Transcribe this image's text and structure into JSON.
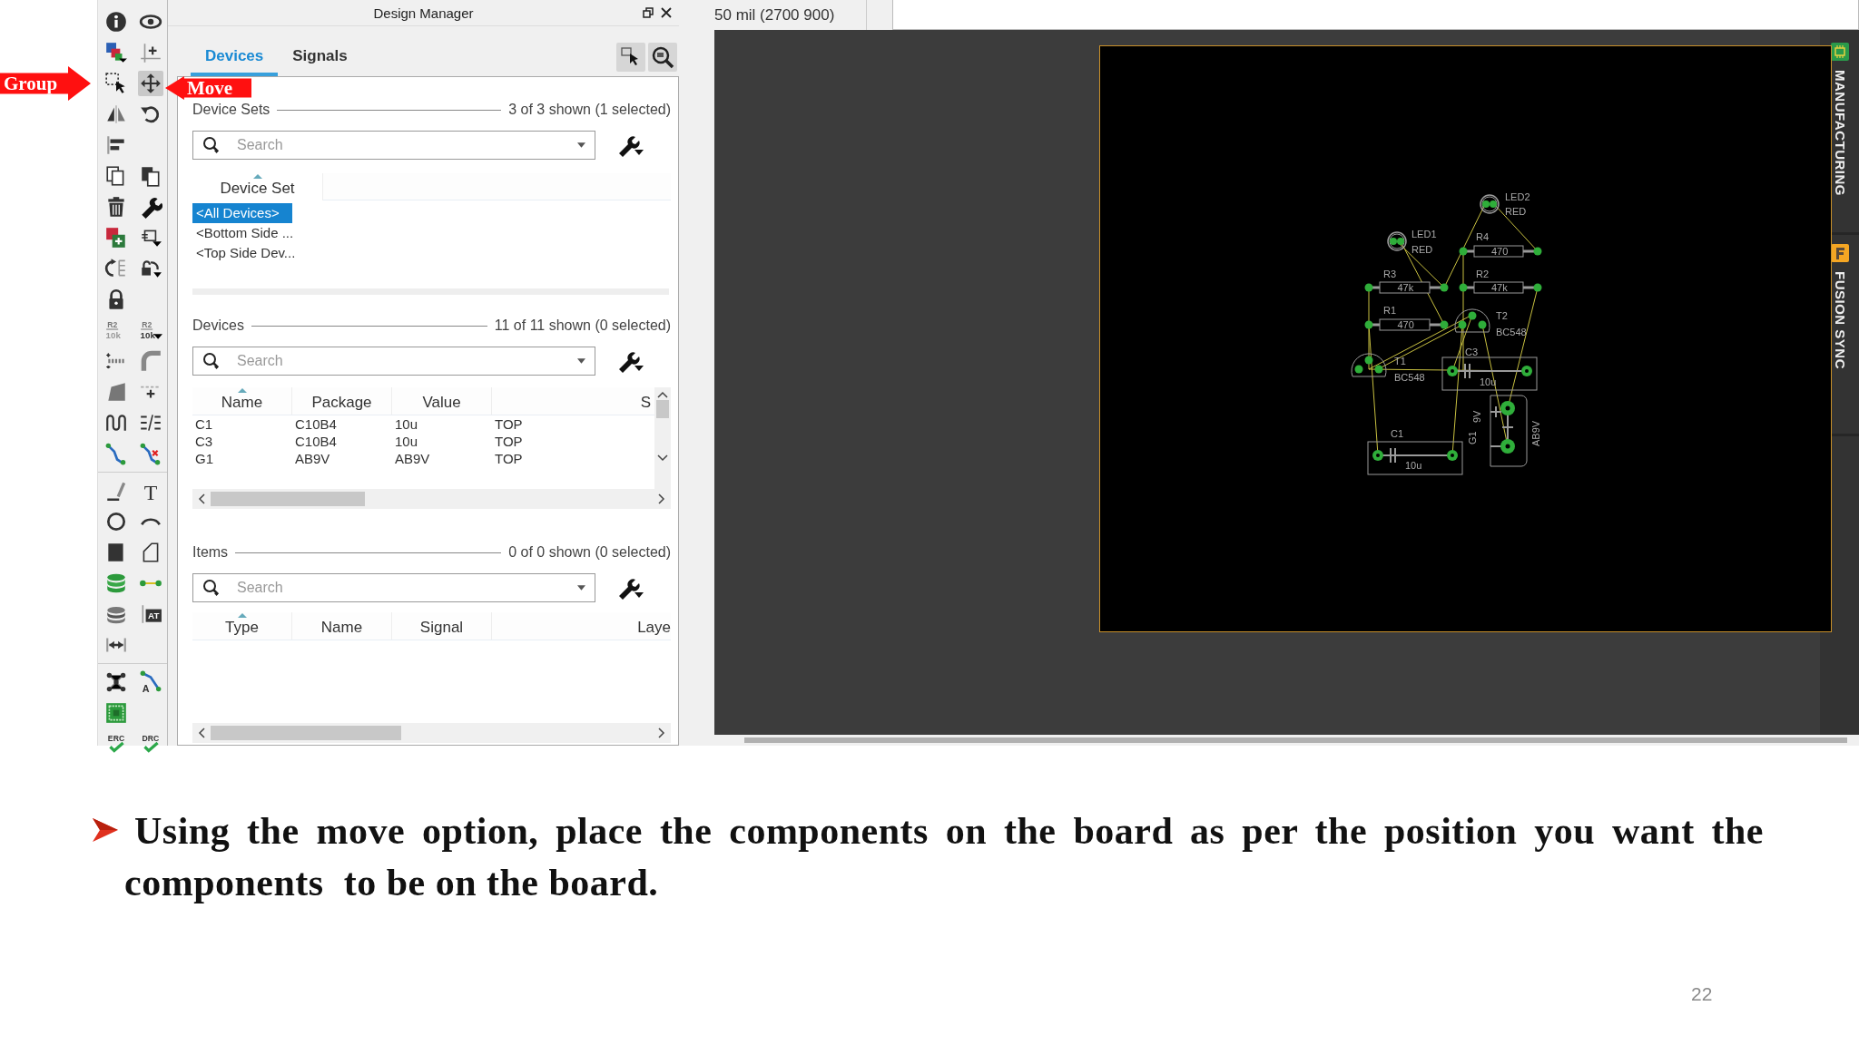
{
  "annotations": [
    {
      "label": "Group",
      "kind": "right"
    },
    {
      "label": "Move",
      "kind": "left"
    }
  ],
  "toolbar": {
    "groups": [
      [
        [
          {
            "kind": "info",
            "selected": false
          },
          {
            "kind": "eye",
            "selected": false
          }
        ],
        [
          {
            "kind": "layers",
            "selected": false
          },
          {
            "kind": "origin",
            "selected": false
          }
        ],
        [
          {
            "kind": "group",
            "selected": false
          },
          {
            "kind": "move",
            "selected": true
          }
        ],
        [
          {
            "kind": "mirror",
            "selected": false
          },
          {
            "kind": "rotate",
            "selected": false
          }
        ],
        [
          {
            "kind": "align",
            "selected": false
          }
        ],
        [
          {
            "kind": "copy",
            "selected": false
          },
          {
            "kind": "paste",
            "selected": false
          }
        ],
        [
          {
            "kind": "delete",
            "selected": false
          },
          {
            "kind": "wrench",
            "selected": false
          }
        ],
        [
          {
            "kind": "add",
            "selected": false
          },
          {
            "kind": "replace",
            "selected": false
          }
        ],
        [
          {
            "kind": "swap",
            "selected": false
          },
          {
            "kind": "lockswap",
            "selected": false
          }
        ],
        [
          {
            "kind": "lock",
            "selected": false
          }
        ],
        [
          {
            "kind": "name",
            "text": [
              "R2",
              "10k"
            ],
            "selected": false
          },
          {
            "kind": "value",
            "text": [
              "R2",
              "10k"
            ],
            "selected": false
          }
        ],
        [
          {
            "kind": "split",
            "selected": false
          },
          {
            "kind": "miter",
            "selected": false
          }
        ],
        [
          {
            "kind": "bevel",
            "selected": false
          },
          {
            "kind": "optimize",
            "selected": false
          }
        ],
        [
          {
            "kind": "meander",
            "selected": false
          },
          {
            "kind": "parallel",
            "selected": false
          }
        ],
        [
          {
            "kind": "route",
            "selected": false
          },
          {
            "kind": "ripup",
            "selected": false
          }
        ]
      ],
      [
        [
          {
            "kind": "line",
            "selected": false
          },
          {
            "kind": "text",
            "text": [
              "T"
            ],
            "selected": false
          }
        ],
        [
          {
            "kind": "circle",
            "selected": false
          },
          {
            "kind": "arc",
            "selected": false
          }
        ],
        [
          {
            "kind": "rect",
            "selected": false
          },
          {
            "kind": "polygon",
            "selected": false
          }
        ],
        [
          {
            "kind": "via",
            "selected": false
          },
          {
            "kind": "signal",
            "selected": false
          }
        ],
        [
          {
            "kind": "hole",
            "selected": false
          },
          {
            "kind": "attribute",
            "text": [
              "AT"
            ],
            "selected": false
          }
        ],
        [
          {
            "kind": "dimension",
            "selected": false
          }
        ]
      ],
      [
        [
          {
            "kind": "ratsnest",
            "selected": false
          },
          {
            "kind": "autoroute",
            "text": [
              "A"
            ],
            "selected": false
          }
        ],
        [
          {
            "kind": "board",
            "selected": false
          }
        ],
        [
          {
            "kind": "erc",
            "text": [
              "ERC"
            ],
            "selected": false
          },
          {
            "kind": "drc",
            "text": [
              "DRC"
            ],
            "selected": false
          }
        ]
      ]
    ]
  },
  "design_manager": {
    "title": "Design Manager",
    "tabs": [
      {
        "label": "Devices",
        "selected": true
      },
      {
        "label": "Signals",
        "selected": false
      }
    ],
    "device_sets": {
      "title": "Device Sets",
      "count": "3 of 3 shown (1 selected)",
      "search": {
        "placeholder": "Search"
      },
      "column": "Device Set",
      "rows": [
        {
          "label": "<All Devices>",
          "selected": true
        },
        {
          "label": "<Bottom Side ...",
          "selected": false
        },
        {
          "label": "<Top Side Dev...",
          "selected": false
        }
      ]
    },
    "devices": {
      "title": "Devices",
      "count": "11 of 11 shown (0 selected)",
      "search": {
        "placeholder": "Search"
      },
      "columns": [
        "Name",
        "Package",
        "Value",
        "S"
      ],
      "rows": [
        [
          "C1",
          "C10B4",
          "10u",
          "TOP"
        ],
        [
          "C3",
          "C10B4",
          "10u",
          "TOP"
        ],
        [
          "G1",
          "AB9V",
          "AB9V",
          "TOP"
        ]
      ]
    },
    "items": {
      "title": "Items",
      "count": "0 of 0 shown (0 selected)",
      "search": {
        "placeholder": "Search"
      },
      "columns": [
        "Type",
        "Name",
        "Signal",
        "Laye"
      ]
    }
  },
  "status": {
    "coordinates": "50 mil (2700 900)"
  },
  "board": {
    "components": [
      {
        "kind": "led",
        "name": "LED2",
        "value": "RED"
      },
      {
        "kind": "led",
        "name": "LED1",
        "value": "RED"
      },
      {
        "kind": "resistor",
        "name": "R4",
        "value": "470"
      },
      {
        "kind": "resistor",
        "name": "R3",
        "value": "47k"
      },
      {
        "kind": "resistor",
        "name": "R2",
        "value": "47k"
      },
      {
        "kind": "resistor",
        "name": "R1",
        "value": "470"
      },
      {
        "kind": "transistor",
        "name": "T2",
        "value": "BC548"
      },
      {
        "kind": "transistor",
        "name": "T1",
        "value": "BC548"
      },
      {
        "kind": "capacitor",
        "name": "C3",
        "value": "10u"
      },
      {
        "kind": "capacitor",
        "name": "C1",
        "value": "10u"
      },
      {
        "kind": "battery",
        "name": "G1",
        "value": "AB9V",
        "rating": "9V"
      }
    ]
  },
  "side_tabs": [
    {
      "label": "MANUFACTURING",
      "kind": "manufacturing"
    },
    {
      "label": "FUSION SYNC",
      "kind": "fusion"
    }
  ],
  "caption": {
    "text": "Using the move option, place the components on the board as per the position you want the components  to be on the board.",
    "page": "22"
  }
}
